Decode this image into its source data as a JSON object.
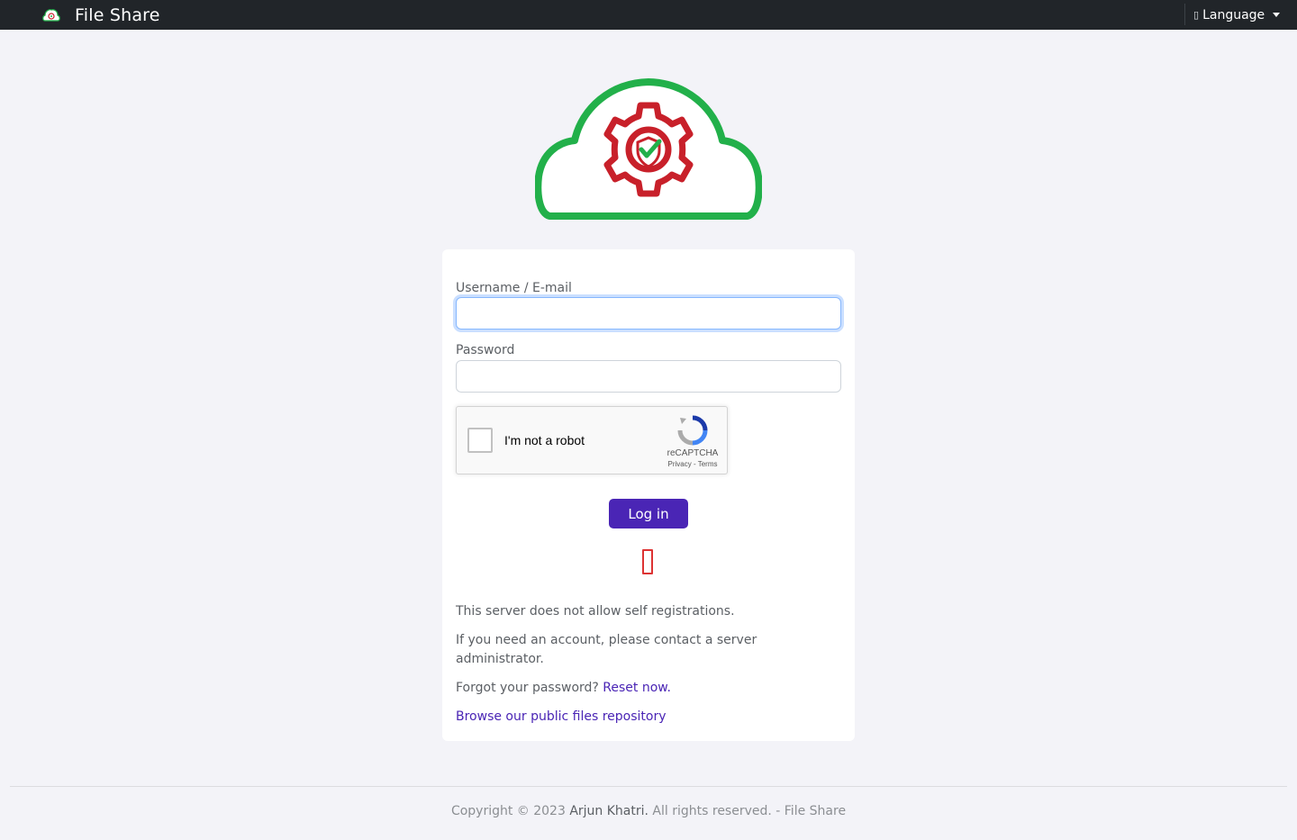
{
  "navbar": {
    "brand": "File Share",
    "brand_logo_icon": "cloud-gear-shield-icon",
    "language_label": "Language",
    "language_icon": "globe-icon"
  },
  "hero": {
    "logo_icon": "cloud-gear-shield-icon",
    "colors": {
      "cloud": "#22b04a",
      "gear": "#c8202a",
      "check": "#22b04a"
    }
  },
  "form": {
    "username_label": "Username / E-mail",
    "username_value": "",
    "password_label": "Password",
    "password_value": "",
    "login_label": "Log in"
  },
  "recaptcha": {
    "label": "I'm not a robot",
    "brand": "reCAPTCHA",
    "privacy": "Privacy",
    "separator": " - ",
    "terms": "Terms"
  },
  "alert_icon": "error-icon",
  "info": {
    "no_self_registration": "This server does not allow self registrations.",
    "contact_admin": "If you need an account, please contact a server administrator.",
    "forgot_prefix": "Forgot your password? ",
    "reset_link": "Reset now.",
    "browse_link": "Browse our public files repository"
  },
  "footer": {
    "prefix": "Copyright © 2023 ",
    "author": "Arjun Khatri.",
    "suffix": " All rights reserved. - File Share"
  },
  "colors": {
    "navbar_bg": "#212529",
    "page_bg": "#f3f3f8",
    "primary": "#4a25b5",
    "focus": "#86b7fe",
    "error": "#dd3333"
  }
}
